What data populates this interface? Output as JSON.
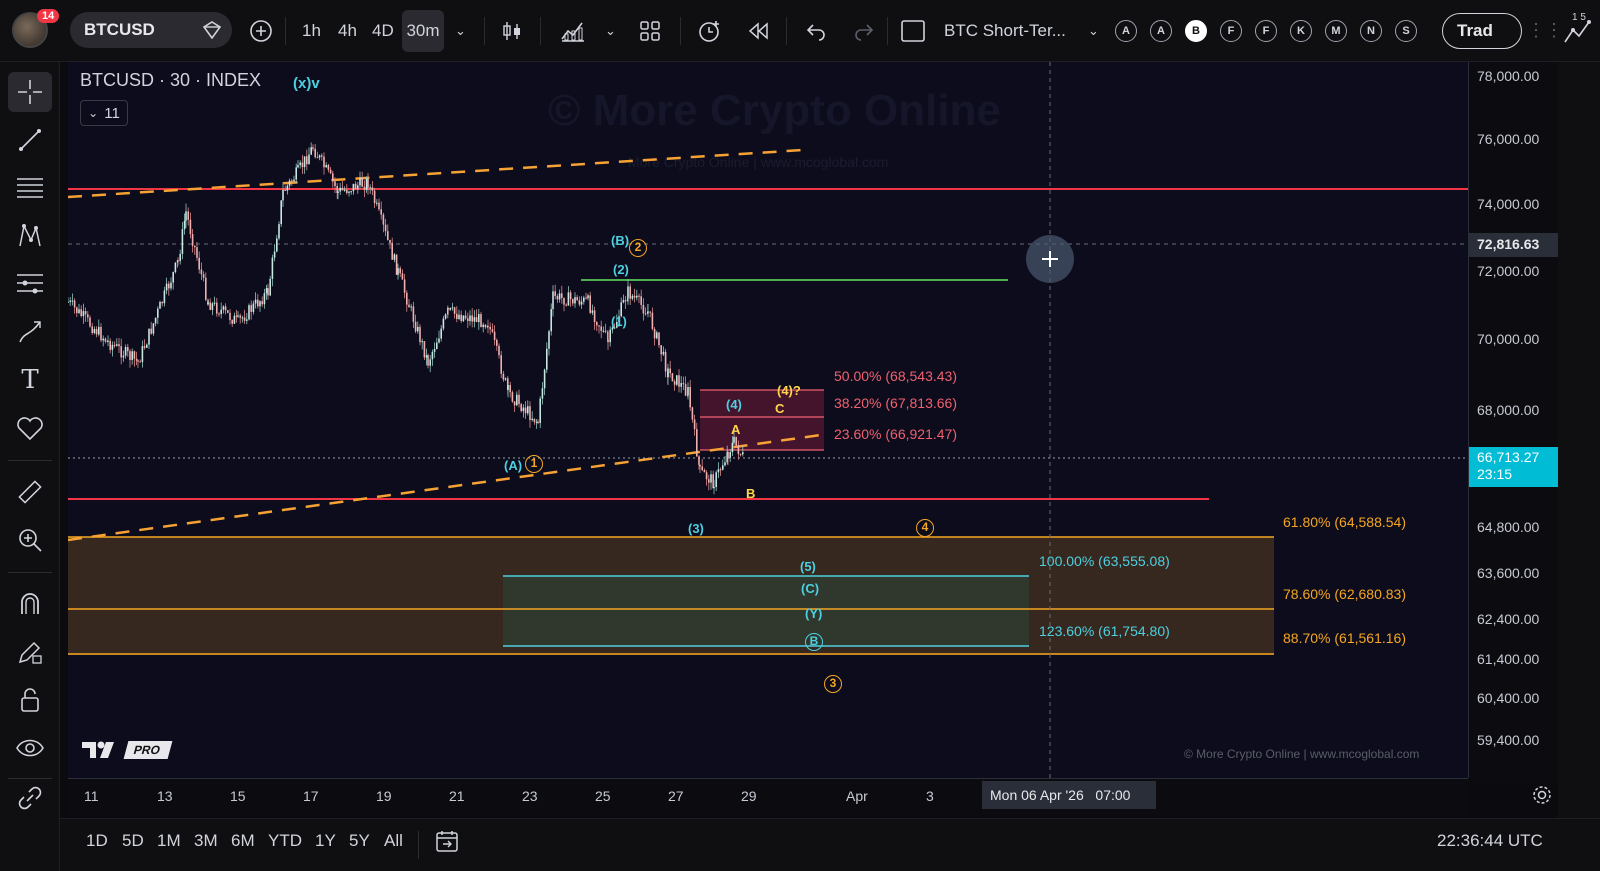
{
  "topbar": {
    "notification_count": "14",
    "symbol": "BTCUSD",
    "intervals": [
      "1h",
      "4h",
      "4D",
      "30m"
    ],
    "active_interval": "30m",
    "layout_name": "BTC Short-Ter...",
    "alert_letters": [
      "A",
      "A",
      "B",
      "F",
      "F",
      "K",
      "M",
      "N",
      "S"
    ],
    "active_letter_index": 2,
    "trade_label": "Trad"
  },
  "right_strip": {
    "top_numbers": "1 5"
  },
  "chart": {
    "title": "BTCUSD · 30 · INDEX",
    "indicator_tag": "(x)v",
    "legend_count": "11",
    "watermark": "© More Crypto Online",
    "watermark_small": "More Crypto Online | www.mcoglobal.com",
    "footer_credit": "© More Crypto Online  |  www.mcoglobal.com",
    "tv_logo": "PRO",
    "current_price": "66,713.27",
    "countdown": "23:15",
    "crosshair_price": "72,816.63",
    "crosshair_time": "Mon 06 Apr '26   07:00",
    "wave_labels": {
      "B_paren": "(B)",
      "two_circle": "2",
      "two_paren": "(2)",
      "one_paren": "(1)",
      "A_paren": "(A)",
      "one_circle": "1",
      "four_paren": "(4)",
      "four_q": "(4)?",
      "C_small": "C",
      "A_small": "A",
      "B_small": "B",
      "three_paren": "(3)",
      "four_circle": "4",
      "five_paren": "(5)",
      "C_paren": "(C)",
      "Y_paren": "(Y)",
      "B_circle": "B",
      "three_circle": "3"
    },
    "fib_labels": {
      "f50": "50.00% (68,543.43)",
      "f382": "38.20% (67,813.66)",
      "f236": "23.60% (66,921.47)",
      "f618": "61.80% (64,588.54)",
      "f100": "100.00% (63,555.08)",
      "f786": "78.60% (62,680.83)",
      "f1236": "123.60% (61,754.80)",
      "f887": "88.70% (61,561.16)"
    }
  },
  "price_axis": [
    "78,000.00",
    "76,000.00",
    "74,000.00",
    "72,000.00",
    "70,000.00",
    "68,000.00",
    "64,800.00",
    "63,600.00",
    "62,400.00",
    "61,400.00",
    "60,400.00",
    "59,400.00"
  ],
  "time_axis": [
    "11",
    "13",
    "15",
    "17",
    "19",
    "21",
    "23",
    "25",
    "27",
    "29",
    "Apr",
    "3"
  ],
  "bottombar": {
    "ranges": [
      "1D",
      "5D",
      "1M",
      "3M",
      "6M",
      "YTD",
      "1Y",
      "5Y",
      "All"
    ],
    "clock": "22:36:44 UTC"
  },
  "colors": {
    "bg": "#0c0c1c",
    "red_line": "#f23645",
    "orange_dash": "#f7a233",
    "green_line": "#4caf50",
    "cyan": "#4dd0e1",
    "fib_red": "#f06070",
    "fib_orange": "#f5a623",
    "yellow": "#ffd54f"
  }
}
